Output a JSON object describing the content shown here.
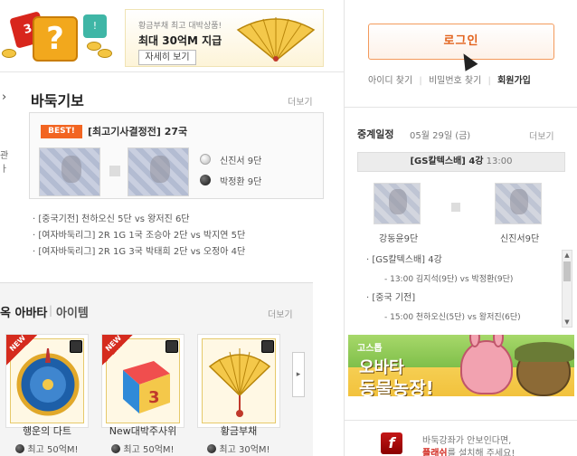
{
  "promo": {
    "subtitle": "황금부채 최고 대박상품!",
    "title": "최대 30억M 지급",
    "button": "자세히 보기",
    "dice_red": "3",
    "dice_teal": "!",
    "question": "?"
  },
  "record": {
    "section_title": "바둑기보",
    "more": "더보기",
    "left_arrow": "›",
    "badge": "BEST!",
    "title": "[최고기사결정전] 27국",
    "white_player": "신진서 9단",
    "black_player": "박정환 9단",
    "list": [
      "· [중국기전] 천하오신 5단 vs 왕저진 6단",
      "· [여자바둑리그] 2R 1G 1국 조승아 2단 vs 박지연 5단",
      "· [여자바둑리그] 2R 1G 3국 박태희 2단 vs 오정아 4단"
    ],
    "left_cut": [
      "관",
      "ㅏ"
    ]
  },
  "avatar": {
    "title": "옥 아바타",
    "separator": "|",
    "tab_item": "아이템",
    "more": "더보기",
    "next": "▸",
    "items": [
      {
        "name": "행운의 다트",
        "price": "최고 50억M!",
        "badge": "NEW"
      },
      {
        "name": "New대박주사위",
        "price": "최고 50억M!",
        "badge": "NEW"
      },
      {
        "name": "황금부채",
        "price": "최고 30억M!",
        "badge": ""
      }
    ],
    "cube_label": "3"
  },
  "login": {
    "button": "로그인",
    "find_id": "아이디 찾기",
    "find_pw": "비밀번호 찾기",
    "join": "회원가입",
    "sep": "|"
  },
  "schedule": {
    "title": "중계일정",
    "date": "05월 29일 (금)",
    "more": "더보기",
    "match_title": "[GS칼텍스배] 4강",
    "match_time": "13:00",
    "player_left": "강동윤9단",
    "player_right": "신진서9단",
    "list": [
      {
        "head": "· [GS칼텍스배] 4강",
        "sub": "- 13:00 김지석(9단) vs 박정환(9단)"
      },
      {
        "head": "· [중국 기전]",
        "sub": "- 15:00 천하오신(5단) vs 왕저진(6단)"
      }
    ],
    "scroll_up": "▲",
    "scroll_down": "▼"
  },
  "ad": {
    "sub": "고스톱",
    "title1": "오바타",
    "title2": "동물농장!"
  },
  "flash": {
    "icon": "f",
    "line1": "바둑강좌가 안보인다면,",
    "line2_hl": "플래쉬",
    "line2_rest": "를 설치해 주세요!"
  },
  "colors": {
    "accent_orange": "#f26522",
    "login_orange": "#e2621c",
    "flash_red": "#d2231a"
  }
}
